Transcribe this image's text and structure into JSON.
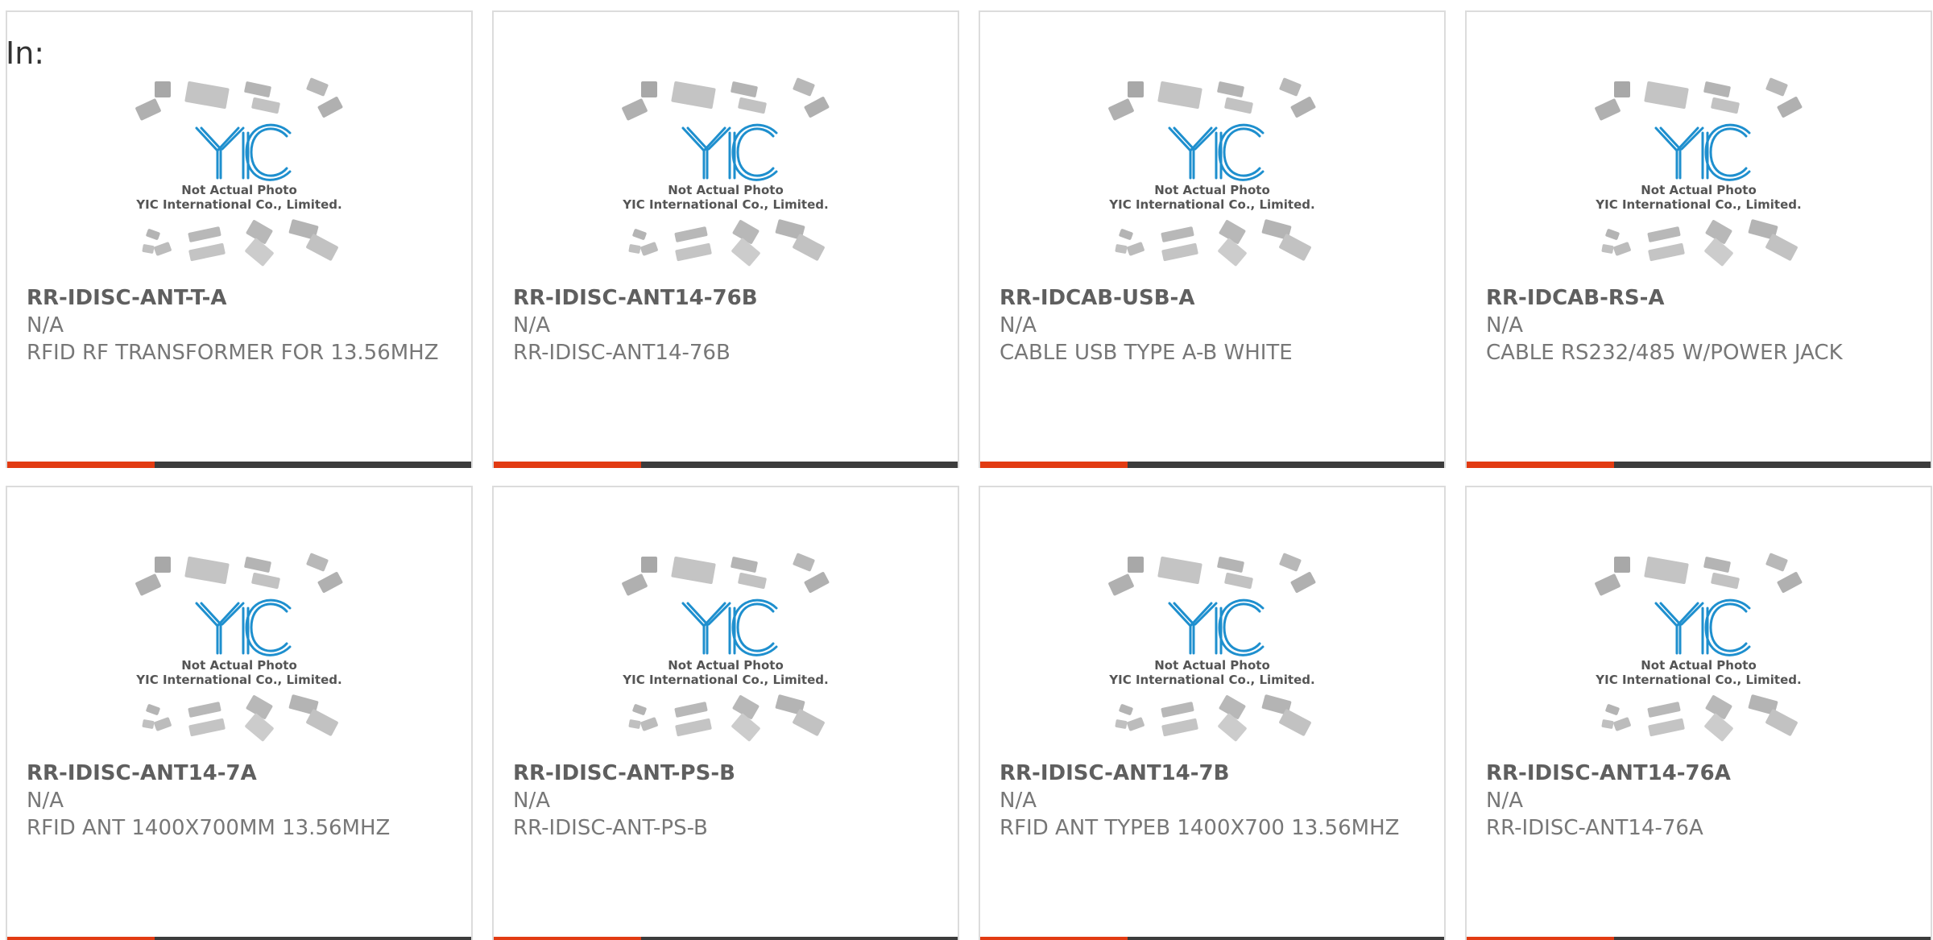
{
  "filter": {
    "label": "In:"
  },
  "placeholder_image": {
    "line1": "Not Actual Photo",
    "line2": "YIC International Co., Limited.",
    "logo_text": "YIC"
  },
  "colors": {
    "accent": "#e23b12",
    "bar": "#3c3c3c",
    "logo": "#1e8fce",
    "chip": "#bdbdbd"
  },
  "products": [
    {
      "part": "RR-IDISC-ANT-T-A",
      "manufacturer": "N/A",
      "description": "RFID RF TRANSFORMER FOR 13.56MHZ"
    },
    {
      "part": "RR-IDISC-ANT14-76B",
      "manufacturer": "N/A",
      "description": "RR-IDISC-ANT14-76B"
    },
    {
      "part": "RR-IDCAB-USB-A",
      "manufacturer": "N/A",
      "description": "CABLE USB TYPE A-B WHITE"
    },
    {
      "part": "RR-IDCAB-RS-A",
      "manufacturer": "N/A",
      "description": "CABLE RS232/485 W/POWER JACK"
    },
    {
      "part": "RR-IDISC-ANT14-7A",
      "manufacturer": "N/A",
      "description": "RFID ANT 1400X700MM 13.56MHZ"
    },
    {
      "part": "RR-IDISC-ANT-PS-B",
      "manufacturer": "N/A",
      "description": "RR-IDISC-ANT-PS-B"
    },
    {
      "part": "RR-IDISC-ANT14-7B",
      "manufacturer": "N/A",
      "description": "RFID ANT TYPEB 1400X700 13.56MHZ"
    },
    {
      "part": "RR-IDISC-ANT14-76A",
      "manufacturer": "N/A",
      "description": "RR-IDISC-ANT14-76A"
    }
  ]
}
